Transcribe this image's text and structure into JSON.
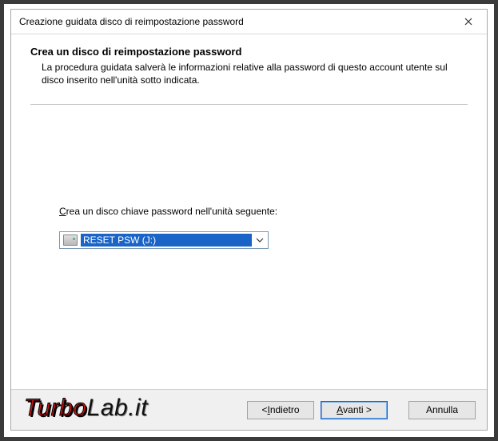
{
  "window": {
    "title": "Creazione guidata disco di reimpostazione password"
  },
  "header": {
    "title": "Crea un disco di reimpostazione password",
    "description": "La procedura guidata salverà le informazioni relative alla password di questo account utente sul disco inserito nell'unità sotto indicata."
  },
  "body": {
    "drive_label_pre": "C",
    "drive_label_rest": "rea un disco chiave password nell'unità seguente:",
    "drive_combo": {
      "selected": "RESET PSW (J:)"
    }
  },
  "footer": {
    "back_pre": "< ",
    "back_u": "I",
    "back_rest": "ndietro",
    "next_u": "A",
    "next_rest": "vanti >",
    "cancel": "Annulla"
  },
  "watermark": {
    "part1": "Turbo",
    "part2": "Lab.it"
  }
}
